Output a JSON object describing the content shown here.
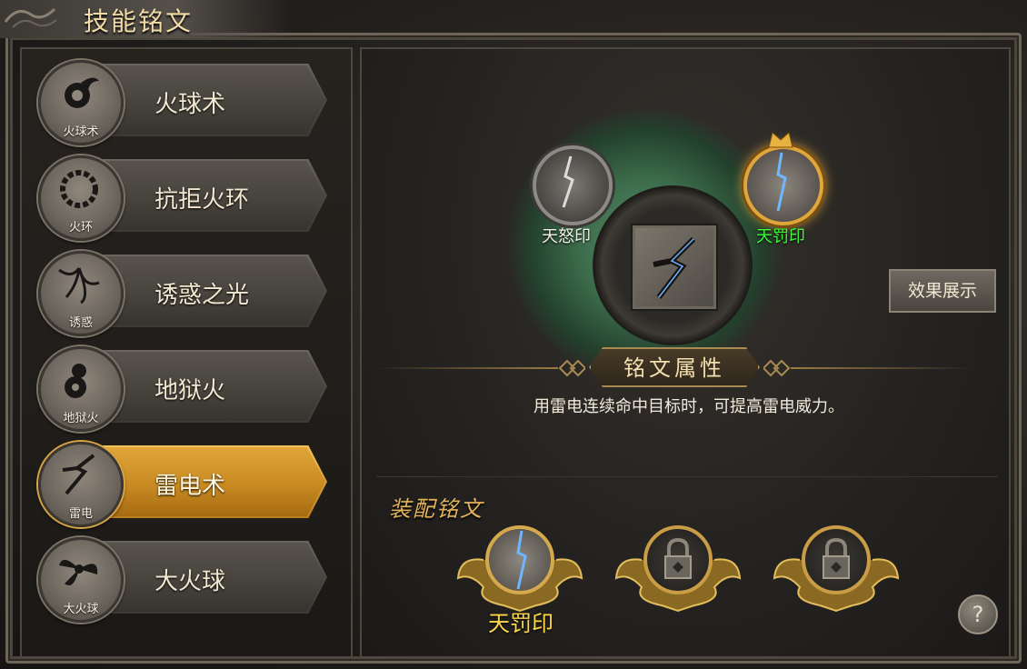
{
  "window": {
    "title": "技能铭文"
  },
  "skills": [
    {
      "name": "火球术",
      "icon_label": "火球术",
      "active": false,
      "icon": "fireball-icon"
    },
    {
      "name": "抗拒火环",
      "icon_label": "火环",
      "active": false,
      "icon": "fire-ring-icon"
    },
    {
      "name": "诱惑之光",
      "icon_label": "诱惑",
      "active": false,
      "icon": "lure-light-icon"
    },
    {
      "name": "地狱火",
      "icon_label": "地狱火",
      "active": false,
      "icon": "hellfire-icon"
    },
    {
      "name": "雷电术",
      "icon_label": "雷电",
      "active": true,
      "icon": "lightning-icon"
    },
    {
      "name": "大火球",
      "icon_label": "大火球",
      "active": false,
      "icon": "big-fireball-icon"
    }
  ],
  "runes": {
    "left": {
      "label": "天怒印",
      "color": "#f2efe6"
    },
    "right": {
      "label": "天罚印",
      "color": "#3aff3a"
    }
  },
  "effect_button": {
    "label": "效果展示"
  },
  "attributes": {
    "title": "铭文属性",
    "description": "用雷电连续命中目标时，可提高雷电威力。"
  },
  "equip": {
    "title": "装配铭文",
    "slots": [
      {
        "label": "天罚印",
        "state": "equipped"
      },
      {
        "label": "",
        "state": "locked"
      },
      {
        "label": "",
        "state": "locked"
      }
    ]
  },
  "help_button": {
    "label": "?"
  },
  "colors": {
    "gold": "#d9a446",
    "active_bar": "#c98a22",
    "equipped_label": "#ffd84a",
    "active_rune_label": "#3aff3a"
  }
}
